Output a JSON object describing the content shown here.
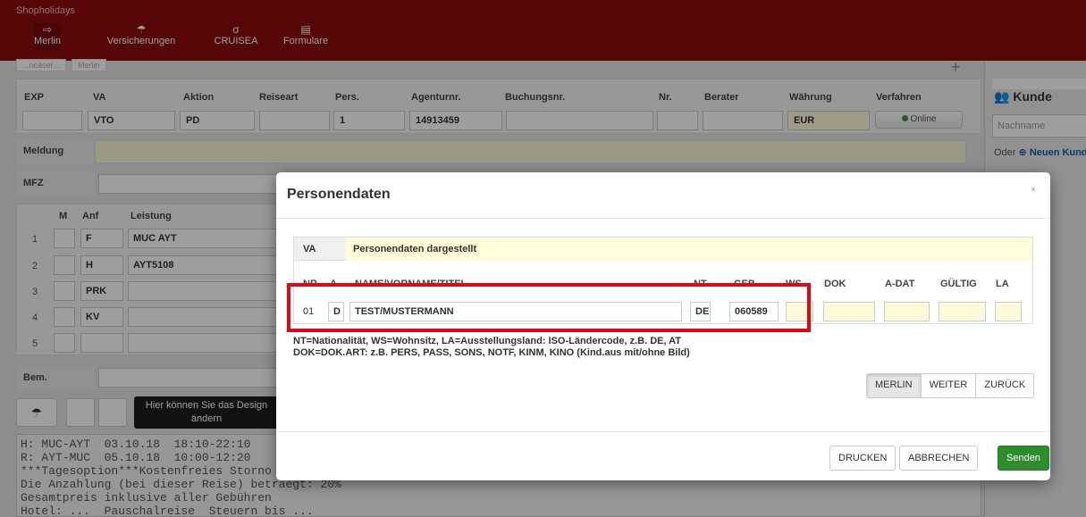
{
  "app": {
    "brand": "Shopholidays"
  },
  "nav": [
    {
      "label": "Merlin",
      "icon": "sign-out-icon",
      "glyph": "⇨"
    },
    {
      "label": "Versicherungen",
      "icon": "umbrella-icon",
      "glyph": "☂"
    },
    {
      "label": "CRUISEA",
      "icon": "cruise-icon",
      "glyph": "σ"
    },
    {
      "label": "Formulare",
      "icon": "document-icon",
      "glyph": "▤"
    }
  ],
  "bg_tabs": [
    "...ncaser...",
    "Merlin"
  ],
  "booking": {
    "headers": [
      "EXP",
      "VA",
      "Aktion",
      "Reiseart",
      "Pers.",
      "Agenturnr.",
      "Buchungsnr.",
      "Nr.",
      "Berater",
      "Währung",
      "Verfahren"
    ],
    "values": {
      "va": "VTO",
      "aktion": "PD",
      "pers": "1",
      "agenturnr": "14913459",
      "waehrung": "EUR"
    },
    "online_label": "Online",
    "meldung_label": "Meldung",
    "mfz_label": "MFZ",
    "service_headers": [
      "M",
      "Anf",
      "Leistung"
    ],
    "rows": [
      {
        "num": "1",
        "anf": "F",
        "leistung": "MUC AYT"
      },
      {
        "num": "2",
        "anf": "H",
        "leistung": "AYT5108"
      },
      {
        "num": "3",
        "anf": "PRK",
        "leistung": ""
      },
      {
        "num": "4",
        "anf": "KV",
        "leistung": ""
      },
      {
        "num": "5",
        "anf": "",
        "leistung": ""
      }
    ],
    "bem_label": "Bem.",
    "tooltip": "Hier können Sie das Design ändern",
    "console": "H: MUC-AYT  03.10.18  18:10-22:10\nR: AYT-MUC  05.10.18  10:00-12:20\n***Tagesoption***Kostenfreies Storno\nDie Anzahlung (bei dieser Reise) betraegt: 20%\nGesamtpreis inklusive aller Gebühren\nHotel: ...  Pauschalreise  Steuern bis ..."
  },
  "right_panel": {
    "title": "Kunde",
    "icon": "users-icon",
    "input_placeholder": "Nachname",
    "oder": "Oder",
    "new_customer": "Neuen Kunden"
  },
  "modal": {
    "title": "Personendaten",
    "close": "×",
    "va_label": "VA",
    "va_text": "Personendaten dargestellt",
    "headers": [
      "NR",
      "A",
      "NAME/VORNAME/TITEL",
      "NT",
      "GEB",
      "WS",
      "DOK",
      "A-DAT",
      "GÜLTIG",
      "LA"
    ],
    "person": {
      "nr": "01",
      "a": "D",
      "name": "TEST/MUSTERMANN",
      "nt": "DE",
      "geb": "060589",
      "ws": "",
      "dok": "",
      "a_dat": "",
      "gueltig": "",
      "la": ""
    },
    "info_line1": "NT=Nationalität, WS=Wohnsitz, LA=Ausstellungsland: ISO-Ländercode, z.B. DE, AT",
    "info_line2": "DOK=DOK.ART: z.B. PERS, PASS, SONS, NOTF, KINM, KINO (Kind.aus mit/ohne Bild)",
    "nav_buttons": [
      "MERLIN",
      "WEITER",
      "ZURÜCK"
    ],
    "footer_buttons": {
      "print": "DRUCKEN",
      "cancel": "ABBRECHEN",
      "send": "Senden"
    }
  },
  "colors": {
    "topbar": "#8b0a0c",
    "highlight": "#e30613",
    "send": "#2e8b2e",
    "yellow_field": "#fffbd8"
  }
}
